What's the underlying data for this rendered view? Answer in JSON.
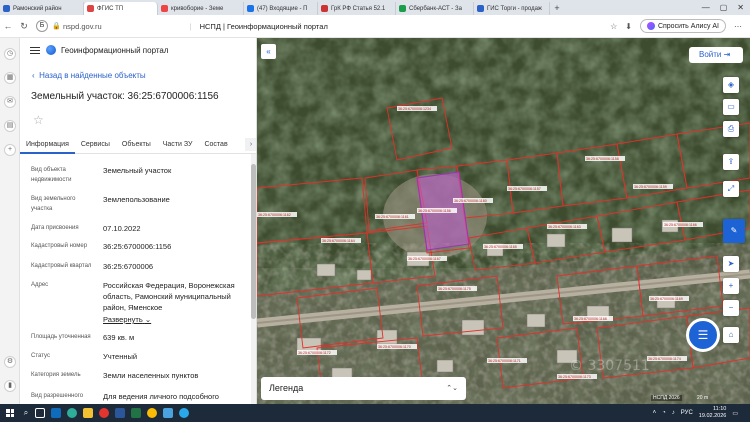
{
  "browser": {
    "tabs": [
      {
        "label": "Рамонский район",
        "color": "#2a62c9"
      },
      {
        "label": "ФГИС ТП",
        "color": "#d44"
      },
      {
        "label": "кривоборие - Земе",
        "color": "#e44"
      },
      {
        "label": "(47) Входящие - П",
        "color": "#1a73e8"
      },
      {
        "label": "ГрК РФ Статья 52.1",
        "color": "#c33"
      },
      {
        "label": "Сбербанк-АСТ - За",
        "color": "#1b9e4b"
      },
      {
        "label": "ГИС Торги - продаж",
        "color": "#2a62c9"
      }
    ],
    "active_tab_index": 1,
    "url": "nspd.gov.ru",
    "page_title": "НСПД | Геоинформационный портал",
    "alice_label": "Спросить Алису AI"
  },
  "portal": {
    "title": "Геоинформационный портал",
    "back_link": "Назад в найденные объекты",
    "object_title": "Земельный участок: 36:25:6700006:1156",
    "tabs": [
      "Информация",
      "Сервисы",
      "Объекты",
      "Части ЗУ",
      "Состав"
    ],
    "active_tab_index": 0,
    "rows": [
      {
        "label": "Вид объекта недвижимости",
        "value": "Земельный участок"
      },
      {
        "label": "Вид земельного участка",
        "value": "Землепользование"
      },
      {
        "label": "Дата присвоения",
        "value": "07.10.2022"
      },
      {
        "label": "Кадастровый номер",
        "value": "36:25:6700006:1156"
      },
      {
        "label": "Кадастровый квартал",
        "value": "36:25:6700006"
      },
      {
        "label": "Адрес",
        "value": "Российская Федерация, Воронежская область, Рамонский муниципальный район, Яменское"
      },
      {
        "label": "Площадь уточненная",
        "value": "639 кв. м"
      },
      {
        "label": "Статус",
        "value": "Учтенный"
      },
      {
        "label": "Категория земель",
        "value": "Земли населенных пунктов"
      },
      {
        "label": "Вид разрешенного",
        "value": "Для ведения личного подсобного"
      }
    ],
    "expand_label": "Развернуть"
  },
  "map": {
    "login_label": "Войти",
    "legend_label": "Легенда",
    "attribution": "НСПД 2026",
    "scale_label": "20 m",
    "watermark": "© 3307511",
    "parcel_labels": [
      "36:25:6700006:1234",
      "36:25:6700006:1158",
      "36:25:6700006:1156",
      "36:25:6700006:1157",
      "36:25:6700006:1159",
      "36:25:6700006:1160",
      "36:25:6700006:1161",
      "36:25:6700006:1162",
      "36:25:6700006:1163",
      "36:25:6700006:1164",
      "36:25:6700006:1165",
      "36:25:6700006:1166",
      "36:25:6700006:1167",
      "36:25:6700006:1168",
      "36:25:6700006:1169",
      "36:25:6700006:1170",
      "36:25:6700006:1171",
      "36:25:6700006:1172",
      "36:25:6700006:1173",
      "36:25:6700006:1174",
      "36:25:6700006:1175"
    ],
    "colors": {
      "parcel_line": "#e0312b",
      "selected_fill": "#c35bd6",
      "accent": "#2a62c9"
    }
  },
  "taskbar": {
    "lang": "РУС",
    "time": "11:10",
    "date": "19.02.2026"
  }
}
